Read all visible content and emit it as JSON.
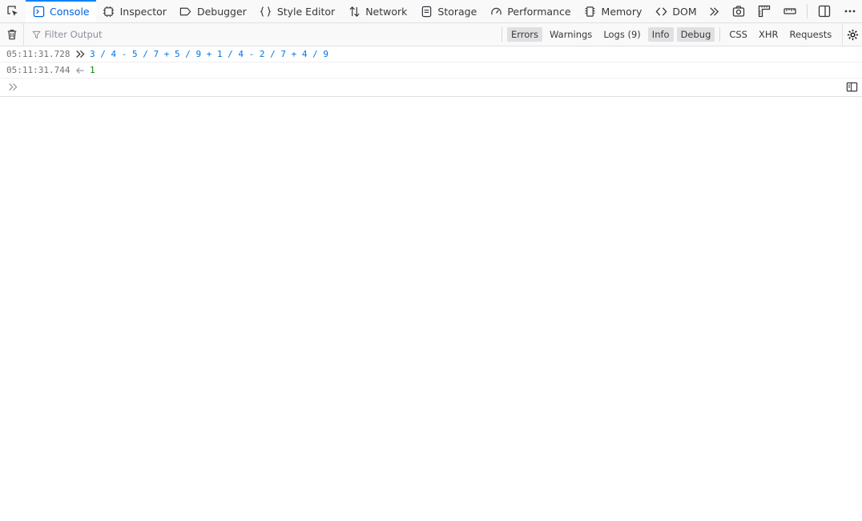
{
  "tabs": [
    {
      "label": "Console",
      "icon": "console-icon",
      "selected": true
    },
    {
      "label": "Inspector",
      "icon": "inspector-icon",
      "selected": false
    },
    {
      "label": "Debugger",
      "icon": "debugger-icon",
      "selected": false
    },
    {
      "label": "Style Editor",
      "icon": "style-editor-icon",
      "selected": false
    },
    {
      "label": "Network",
      "icon": "network-icon",
      "selected": false
    },
    {
      "label": "Storage",
      "icon": "storage-icon",
      "selected": false
    },
    {
      "label": "Performance",
      "icon": "performance-icon",
      "selected": false
    },
    {
      "label": "Memory",
      "icon": "memory-icon",
      "selected": false
    },
    {
      "label": "DOM",
      "icon": "dom-icon",
      "selected": false
    }
  ],
  "filter": {
    "placeholder": "Filter Output",
    "levels": [
      {
        "label": "Errors",
        "on": true
      },
      {
        "label": "Warnings",
        "on": false
      },
      {
        "label": "Logs (9)",
        "on": false
      },
      {
        "label": "Info",
        "on": true
      },
      {
        "label": "Debug",
        "on": true
      }
    ],
    "categories": [
      {
        "label": "CSS",
        "on": false
      },
      {
        "label": "XHR",
        "on": false
      },
      {
        "label": "Requests",
        "on": false
      }
    ]
  },
  "messages": [
    {
      "timestamp": "05:11:31.728",
      "type": "command",
      "text": "3 / 4 - 5 / 7 + 5 / 9 + 1 / 4 - 2 / 7 + 4 / 9"
    },
    {
      "timestamp": "05:11:31.744",
      "type": "result",
      "text": "1"
    }
  ],
  "colors": {
    "accent": "#0a84ff",
    "selected_text": "#0060df",
    "command": "#0074e8",
    "result": "#058b00"
  }
}
